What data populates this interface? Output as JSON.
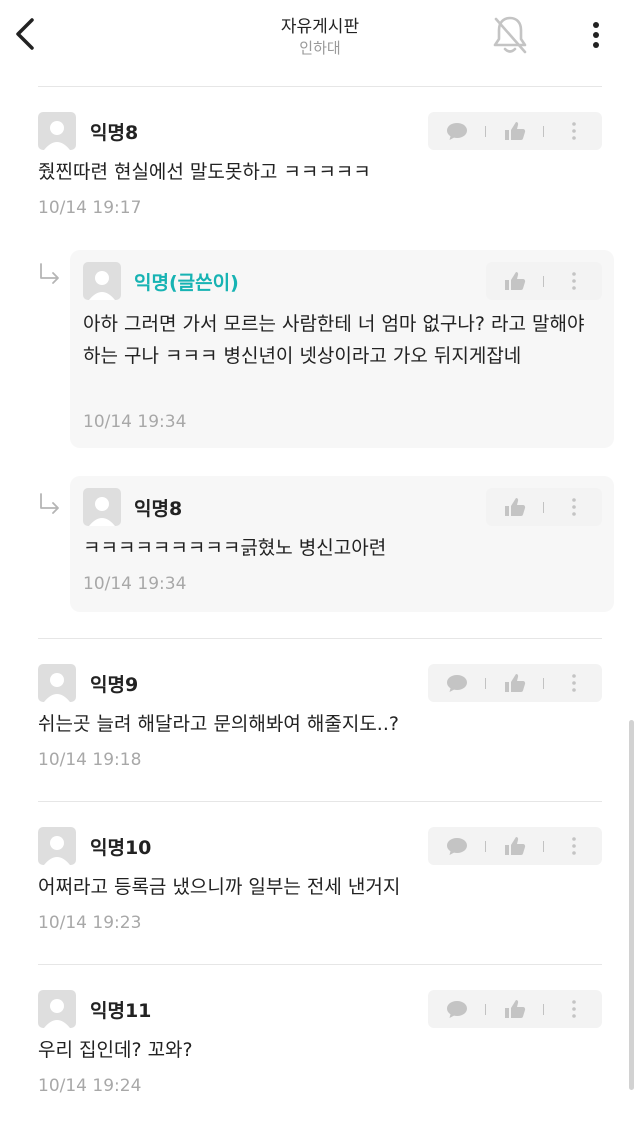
{
  "header": {
    "title": "자유게시판",
    "subtitle": "인하대"
  },
  "comments": [
    {
      "author": "익명8",
      "text": "줬찐따련 현실에선 말도못하고 ㅋㅋㅋㅋㅋ",
      "time": "10/14 19:17"
    },
    {
      "author": "익명(글쓴이)",
      "text": "아하 그러면 가서 모르는 사람한테 너 엄마 없구나? 라고 말해야 하는 구나 ㅋㅋㅋ 병신년이 넷상이라고 가오 뒤지게잡네",
      "time": "10/14 19:34"
    },
    {
      "author": "익명8",
      "text": "ㅋㅋㅋㅋㅋㅋㅋㅋㅋ긁혔노 병신고아련",
      "time": "10/14 19:34"
    },
    {
      "author": "익명9",
      "text": "쉬는곳 늘려 해달라고 문의해봐여 해줄지도..?",
      "time": "10/14 19:18"
    },
    {
      "author": "익명10",
      "text": "어쩌라고 등록금 냈으니까 일부는 전세 낸거지",
      "time": "10/14 19:23"
    },
    {
      "author": "익명11",
      "text": "우리 집인데? 꼬와?",
      "time": "10/14 19:24"
    }
  ],
  "icons": {
    "back": "chevron-left-icon",
    "notifications_off": "bell-off-icon",
    "more": "more-vertical-icon",
    "reply": "comment-icon",
    "like": "thumbs-up-icon",
    "options": "more-vertical-icon",
    "reply_indicator": "reply-arrow-icon"
  },
  "colors": {
    "op_author": "#17b3b3",
    "timestamp": "#a8a8a8",
    "action_bg": "#f3f3f3",
    "reply_bg": "#f7f7f7"
  }
}
